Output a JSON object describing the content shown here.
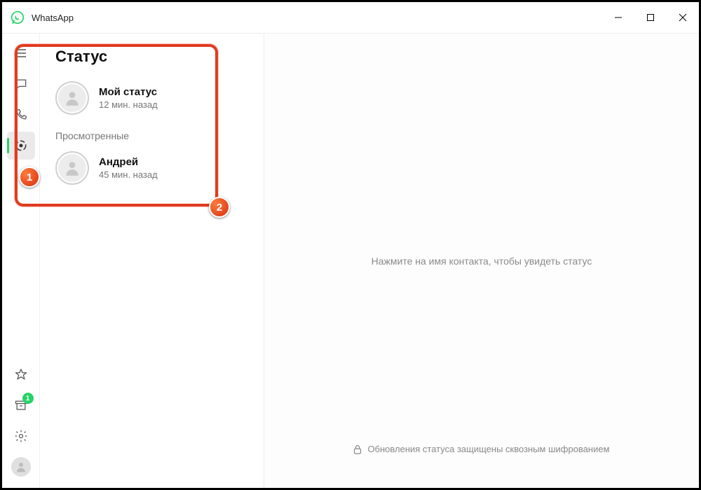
{
  "title": "WhatsApp",
  "panel": {
    "heading": "Статус",
    "my_status": {
      "name": "Мой статус",
      "time": "12 мин. назад"
    },
    "viewed_label": "Просмотренные",
    "viewed": [
      {
        "name": "Андрей",
        "time": "45 мин. назад"
      }
    ]
  },
  "main": {
    "prompt": "Нажмите на имя контакта, чтобы увидеть статус",
    "encryption": "Обновления статуса защищены сквозным шифрованием"
  },
  "sidebar": {
    "archive_badge": "1"
  },
  "callouts": {
    "one": "1",
    "two": "2"
  }
}
